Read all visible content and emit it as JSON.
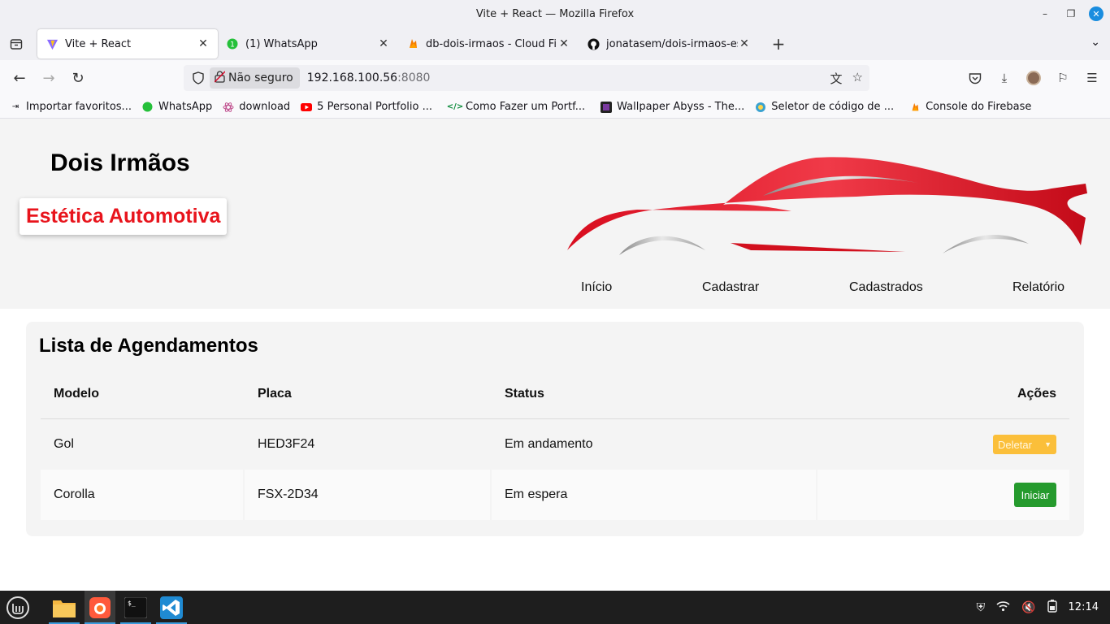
{
  "window": {
    "title": "Vite + React — Mozilla Firefox"
  },
  "tabs": [
    {
      "label": "Vite + React"
    },
    {
      "label": "(1) WhatsApp"
    },
    {
      "label": "db-dois-irmaos - Cloud Firest"
    },
    {
      "label": "jonatasem/dois-irmaos-estet"
    }
  ],
  "urlbar": {
    "security_label": "Não seguro",
    "host": "192.168.100.56",
    "port": ":8080"
  },
  "bookmarks": [
    {
      "label": "Importar favoritos..."
    },
    {
      "label": "WhatsApp"
    },
    {
      "label": "download"
    },
    {
      "label": "5 Personal Portfolio ..."
    },
    {
      "label": "Como Fazer um Portf..."
    },
    {
      "label": "Wallpaper Abyss - The..."
    },
    {
      "label": "Seletor de código de ..."
    },
    {
      "label": "Console do Firebase"
    }
  ],
  "header": {
    "title": "Dois Irmãos",
    "subtitle": "Estética Automotiva",
    "nav": [
      "Início",
      "Cadastrar",
      "Cadastrados",
      "Relatório"
    ]
  },
  "list": {
    "title": "Lista de Agendamentos",
    "columns": [
      "Modelo",
      "Placa",
      "Status",
      "Ações"
    ],
    "rows": [
      {
        "modelo": "Gol",
        "placa": "HED3F24",
        "status": "Em andamento",
        "action": "Deletar"
      },
      {
        "modelo": "Corolla",
        "placa": "FSX-2D34",
        "status": "Em espera",
        "action": "Iniciar"
      }
    ]
  },
  "taskbar": {
    "clock": "12:14"
  },
  "colors": {
    "accent_red": "#e8141c",
    "delete_button": "#fbbf3a",
    "start_button": "#259a2d"
  }
}
